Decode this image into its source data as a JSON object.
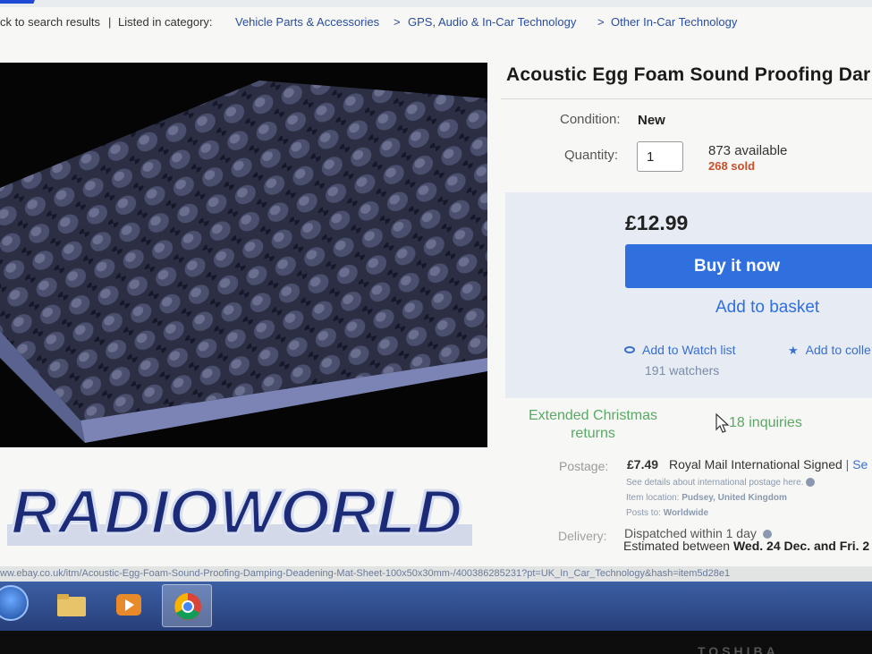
{
  "breadcrumb": {
    "back_link": "ck to search results",
    "separator": "|",
    "listed_in": "Listed in category:",
    "cat1": "Vehicle Parts & Accessories",
    "gt1": ">",
    "cat2": "GPS, Audio & In-Car Technology",
    "gt2": ">",
    "cat3": "Other In-Car Technology"
  },
  "product": {
    "title": "Acoustic Egg Foam Sound Proofing Dar",
    "brand_logo_text": "RADIOWORLD",
    "condition_label": "Condition:",
    "condition_value": "New",
    "quantity_label": "Quantity:",
    "quantity_value": "1",
    "available": "873 available",
    "sold": "268 sold"
  },
  "buybox": {
    "price": "£12.99",
    "buy_now": "Buy it now",
    "add_to_basket": "Add to basket",
    "watch_list": "Add to Watch list",
    "watchers": "191 watchers",
    "add_to_collection": "Add to colle",
    "watch_icon": "eye-icon",
    "collection_icon": "star-icon"
  },
  "returns": {
    "text": "Extended Christmas returns",
    "inquiries": "18 inquiries"
  },
  "postage": {
    "label": "Postage:",
    "price": "£7.49",
    "service": "Royal Mail International Signed",
    "see_link": "| Se",
    "details_line": "See details about international postage here.",
    "item_location_label": "Item location:",
    "item_location": "Pudsey, United Kingdom",
    "posts_to_label": "Posts to:",
    "posts_to": "Worldwide"
  },
  "delivery": {
    "label": "Delivery:",
    "dispatch": "Dispatched within 1 day",
    "estimate_prefix": "Estimated between",
    "estimate_dates": "Wed. 24 Dec. and Fri. 2"
  },
  "statusbar": {
    "url": "ww.ebay.co.uk/itm/Acoustic-Egg-Foam-Sound-Proofing-Damping-Deadening-Mat-Sheet-100x50x30mm-/400386285231?pt=UK_In_Car_Technology&hash=item5d28e1"
  },
  "bezel": {
    "brand": "TOSHIBA"
  },
  "colors": {
    "buy_button": "#2f6fde",
    "link": "#2a4da0",
    "sold": "#c8502a",
    "returns_green": "#5aa865",
    "buybox_bg": "#e6ebf4"
  }
}
